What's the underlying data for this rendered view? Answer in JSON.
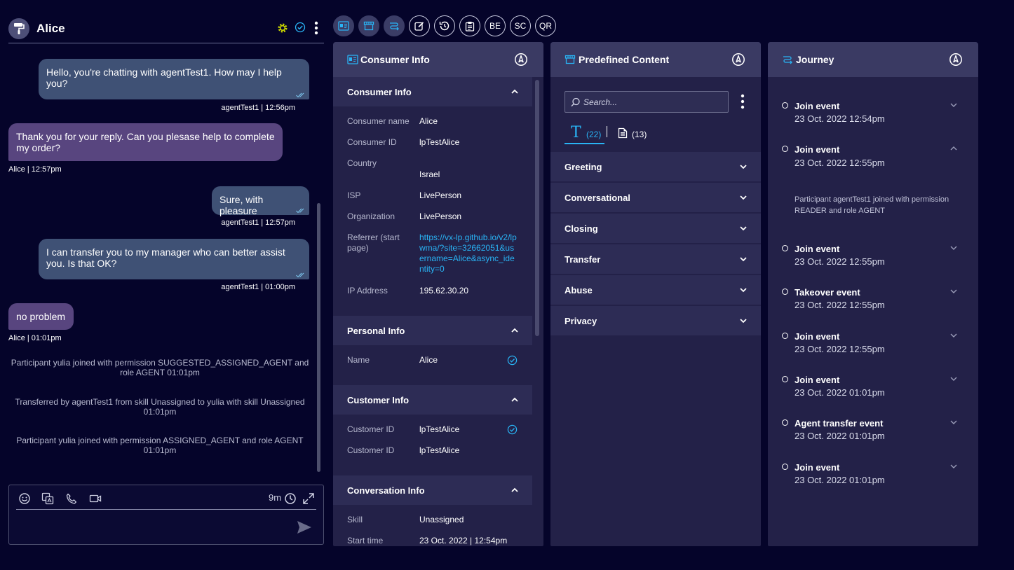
{
  "chat": {
    "consumer_name": "Alice",
    "messages": [
      {
        "text": "Hello, you're chatting with agentTest1. How may I help you?",
        "meta": "agentTest1  |  12:56pm"
      },
      {
        "text": "Thank you for your reply.  Can you plesase help to complete my order?",
        "meta": "Alice  |  12:57pm"
      },
      {
        "text": "Sure, with pleasure",
        "meta": "agentTest1  |  12:57pm"
      },
      {
        "text": "I can transfer you to my manager who can better assist you. Is that OK?",
        "meta": "agentTest1  |  01:00pm"
      },
      {
        "text": "no problem",
        "meta": "Alice  |  01:01pm"
      }
    ],
    "system_messages": [
      "Participant yulia joined with permission SUGGESTED_ASSIGNED_AGENT and role AGENT 01:01pm",
      "Transferred by agentTest1 from skill Unassigned to yulia with skill Unassigned 01:01pm",
      "Participant yulia joined with permission ASSIGNED_AGENT and role AGENT 01:01pm"
    ],
    "composer": {
      "timer": "9m"
    }
  },
  "toolbar": {
    "be": "BE",
    "sc": "SC",
    "qr": "QR"
  },
  "consumer_info": {
    "title": "Consumer Info",
    "sections": {
      "consumer": {
        "title": "Consumer Info",
        "fields": [
          {
            "label": "Consumer name",
            "value": "Alice"
          },
          {
            "label": "Consumer ID",
            "value": "lpTestAlice"
          },
          {
            "label": "Country",
            "value": "Israel"
          },
          {
            "label": "ISP",
            "value": "LivePerson"
          },
          {
            "label": "Organization",
            "value": "LivePerson"
          },
          {
            "label": "Referrer (start page)",
            "value": "https://vx-lp.github.io/v2/lpwma/?site=32662051&username=Alice&async_identity=0"
          },
          {
            "label": "IP Address",
            "value": "195.62.30.20"
          }
        ]
      },
      "personal": {
        "title": "Personal Info",
        "fields": [
          {
            "label": "Name",
            "value": "Alice"
          }
        ]
      },
      "customer": {
        "title": "Customer Info",
        "fields": [
          {
            "label": "Customer ID",
            "value": "lpTestAlice"
          },
          {
            "label": "Customer ID",
            "value": "lpTestAlice"
          }
        ]
      },
      "conversation": {
        "title": "Conversation Info",
        "fields": [
          {
            "label": "Skill",
            "value": "Unassigned"
          },
          {
            "label": "Start time",
            "value": "23 Oct. 2022 | 12:54pm"
          }
        ]
      }
    }
  },
  "predefined": {
    "title": "Predefined Content",
    "search_placeholder": "Search...",
    "tabs": {
      "text_glyph": "T",
      "text_count": "(22)",
      "doc_count": "(13)"
    },
    "categories": [
      "Greeting",
      "Conversational",
      "Closing",
      "Transfer",
      "Abuse",
      "Privacy"
    ]
  },
  "journey": {
    "title": "Journey",
    "events": [
      {
        "title": "Join event",
        "time": "23 Oct. 2022 12:54pm"
      },
      {
        "title": "Join event",
        "time": "23 Oct. 2022 12:55pm",
        "detail": "Participant agentTest1 joined with permission READER and role AGENT"
      },
      {
        "title": "Join event",
        "time": "23 Oct. 2022 12:55pm"
      },
      {
        "title": "Takeover event",
        "time": "23 Oct. 2022 12:55pm"
      },
      {
        "title": "Join event",
        "time": "23 Oct. 2022 12:55pm"
      },
      {
        "title": "Join event",
        "time": "23 Oct. 2022 01:01pm"
      },
      {
        "title": "Agent transfer event",
        "time": "23 Oct. 2022 01:01pm"
      },
      {
        "title": "Join event",
        "time": "23 Oct. 2022 01:01pm"
      }
    ]
  },
  "colors": {
    "accent": "#29b4f5",
    "agent_bubble": "#3f5175",
    "consumer_bubble": "#58457f",
    "panel": "#232148",
    "background": "#05042a"
  },
  "icons": [
    "paint-roller-icon",
    "gear-icon",
    "check-circle-icon",
    "kebab-icon",
    "emoji-icon",
    "translate-icon",
    "phone-icon",
    "video-icon",
    "clock-icon",
    "expand-icon",
    "send-icon",
    "consumer-info-icon",
    "predefined-content-icon",
    "journey-icon",
    "edit-icon",
    "history-icon",
    "clipboard-icon",
    "compass-icon",
    "search-icon",
    "document-icon",
    "chevron-up-icon",
    "chevron-down-icon"
  ]
}
